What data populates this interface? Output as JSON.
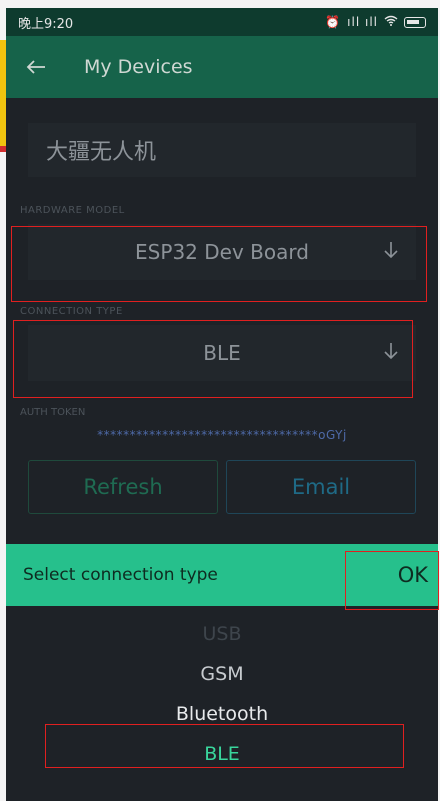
{
  "status_bar": {
    "time": "晚上9:20",
    "signal_text": "ıll ıll"
  },
  "app_bar": {
    "title": "My Devices"
  },
  "device": {
    "name": "大疆无人机"
  },
  "hardware": {
    "label": "HARDWARE MODEL",
    "value": "ESP32 Dev Board"
  },
  "connection": {
    "label": "CONNECTION TYPE",
    "value": "BLE"
  },
  "auth": {
    "label": "AUTH TOKEN",
    "value": "**********************************oGYj"
  },
  "buttons": {
    "refresh": "Refresh",
    "email": "Email"
  },
  "picker": {
    "title": "Select connection type",
    "ok": "OK",
    "options": [
      "USB",
      "GSM",
      "Bluetooth",
      "BLE"
    ],
    "selected": "BLE"
  },
  "colors": {
    "accent": "#26c08c",
    "app_bar": "#16634a",
    "highlight": "#e02020"
  }
}
